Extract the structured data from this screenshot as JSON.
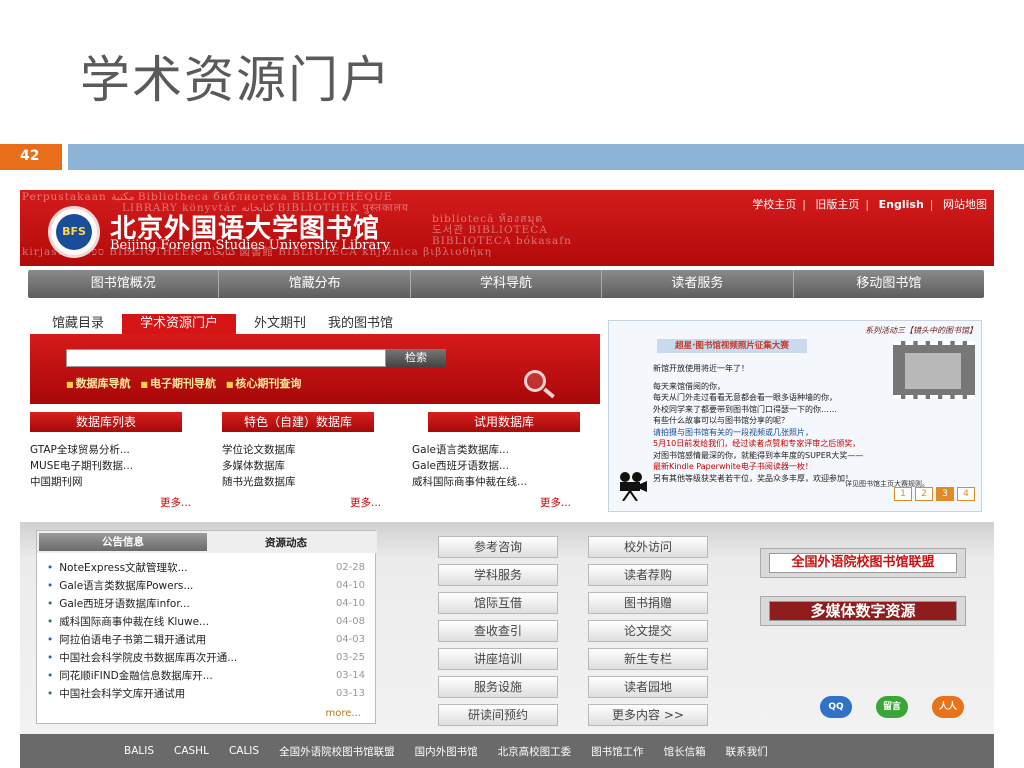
{
  "slide": {
    "title": "学术资源门户",
    "number": "42"
  },
  "header": {
    "bg_lines": [
      "Perpustakaan مكتبة Bibliotheca библиотека BIBLIOTHÈQUE",
      "LIBRARY könyvtár كتابخانه BIBLIOTHEK पुस्तकालय",
      "bibliotecă ห้องสมุด",
      "도서관 BIBLIOTECA",
      "BIBLIOTECA bókasafn",
      "kirjasto ספריה BIBLIOTHEEK کتابخانه 図書館 BIBLIOTECA knjižnica βιβλιοθήκη"
    ],
    "logo": "BFS",
    "cn_name": "北京外国语大学图书馆",
    "en_name": "Beijing Foreign Studies University Library",
    "top_links": [
      "学校主页",
      "旧版主页",
      "English",
      "网站地图"
    ],
    "sep": "|"
  },
  "nav": [
    "图书馆概况",
    "馆藏分布",
    "学科导航",
    "读者服务",
    "移动图书馆"
  ],
  "search": {
    "tabs": [
      "馆藏目录",
      "学术资源门户",
      "外文期刊",
      "我的图书馆"
    ],
    "button": "检索",
    "quick_links": [
      "数据库导航",
      "电子期刊导航",
      "核心期刊查询"
    ]
  },
  "columns": [
    {
      "header": "数据库列表",
      "items": [
        "GTAP全球贸易分析...",
        "MUSE电子期刊数据...",
        "中国期刊网"
      ],
      "more": "更多..."
    },
    {
      "header": "特色（自建）数据库",
      "items": [
        "学位论文数据库",
        "多媒体数据库",
        "随书光盘数据库"
      ],
      "more": "更多..."
    },
    {
      "header": "试用数据库",
      "items": [
        "Gale语言类数据库...",
        "Gale西班牙语数据...",
        "威科国际商事仲裁在线..."
      ],
      "more": "更多..."
    }
  ],
  "promo": {
    "series": "系列活动三【镜头中的图书馆】",
    "title": "超星·图书馆视频照片征集大赛",
    "lines": [
      "新馆开放使用将近一年了！",
      "",
      "每天来馆借阅的你，",
      "每天从门外走过看看无意都会看一眼多语种墙的你，",
      "外校同学来了都要带到图书馆门口得瑟一下的你……",
      "有些什么故事可以与图书馆分享的呢？",
      "请拍摄与图书馆有关的一段视频或几张照片，",
      "5月10日前发给我们，经过读者点赞和专家评审之后颁奖，",
      "对图书馆感情最深的你，就能得到本年度的SUPER大奖——",
      "最新Kindle Paperwhite电子书阅读器一枚！",
      "另有其他等级获奖者若干位，奖品众多丰厚，欢迎参加！"
    ],
    "footer": "详见图书馆主页大赛规则。",
    "pages": [
      "1",
      "2",
      "3",
      "4"
    ]
  },
  "news": {
    "tab_announce": "公告信息",
    "tab_resource": "资源动态",
    "items": [
      {
        "title": "NoteExpress文献管理软...",
        "date": "02-28"
      },
      {
        "title": "Gale语言类数据库Powers...",
        "date": "04-10"
      },
      {
        "title": "Gale西班牙语数据库infor...",
        "date": "04-10"
      },
      {
        "title": "威科国际商事仲裁在线 Kluwe...",
        "date": "04-08"
      },
      {
        "title": "阿拉伯语电子书第二辑开通试用",
        "date": "04-03"
      },
      {
        "title": "中国社会科学院皮书数据库再次开通...",
        "date": "03-25"
      },
      {
        "title": "同花顺iFIND金融信息数据库开...",
        "date": "03-14"
      },
      {
        "title": "中国社会科学文库开通试用",
        "date": "03-13"
      }
    ],
    "more": "more..."
  },
  "services": {
    "left": [
      "参考咨询",
      "学科服务",
      "馆际互借",
      "查收查引",
      "讲座培训",
      "服务设施",
      "研读间预约"
    ],
    "right": [
      "校外访问",
      "读者荐购",
      "图书捐赠",
      "论文提交",
      "新生专栏",
      "读者园地",
      "更多内容 >>"
    ]
  },
  "banners": [
    "全国外语院校图书馆联盟",
    "多媒体数字资源"
  ],
  "social": [
    "QQ",
    "留言",
    "人人"
  ],
  "footer_links": [
    "BALIS",
    "CASHL",
    "CALIS",
    "全国外语院校图书馆联盟",
    "国内外图书馆",
    "北京高校图工委",
    "图书馆工作",
    "馆长信箱",
    "联系我们"
  ],
  "colors": {
    "brand_red": "#c41212",
    "slide_orange": "#e86e1a",
    "slide_blue": "#8db3d6"
  }
}
